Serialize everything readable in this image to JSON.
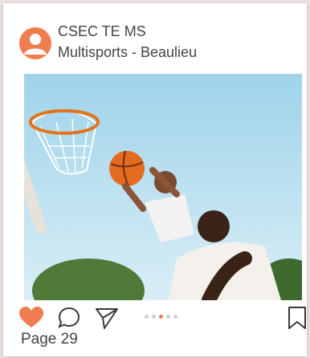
{
  "post": {
    "account_name": "CSEC TE MS",
    "subtitle": "Multisports - Beaulieu",
    "page_label": "Page 29",
    "photo_description_icon": "basketball-photo",
    "carousel": {
      "count": 5,
      "active_index": 2
    },
    "liked": true
  },
  "icons": {
    "avatar": "user-avatar-icon",
    "like": "heart-icon",
    "comment": "comment-bubble-icon",
    "share": "send-paper-plane-icon",
    "save": "bookmark-icon"
  },
  "colors": {
    "accent": "#ef7d4f",
    "text": "#444444",
    "icon_stroke": "#3a3a3a",
    "dot_inactive": "#cfcfcf"
  }
}
